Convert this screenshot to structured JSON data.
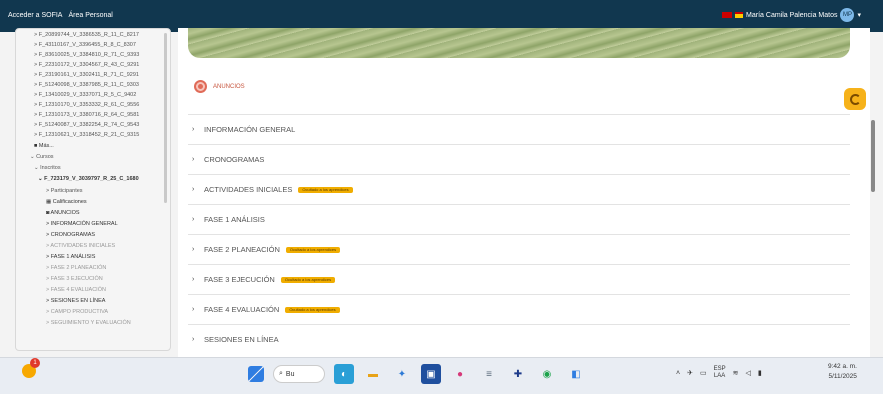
{
  "topbar": {
    "left_links": [
      "Acceder a SOFIA",
      "Área Personal"
    ],
    "user_name": "María Camila Palencia Matos",
    "avatar_initials": "MP"
  },
  "sidebar": {
    "items": [
      "> F_20899744_V_3386535_R_11_C_8217",
      "> F_43110167_V_3396455_R_8_C_8307",
      "> F_83610025_V_3384810_R_71_C_9393",
      "> F_22310172_V_3304567_R_43_C_9291",
      "> F_23190161_V_3302411_R_71_C_9291",
      "> F_51240098_V_3387985_R_11_C_9303",
      "> F_13410029_V_3337071_R_5_C_9402",
      "> F_12310170_V_3353332_R_61_C_9556",
      "> F_12310173_V_3380716_R_64_C_9581",
      "> F_51240087_V_3382254_R_74_C_9543",
      "> F_12310621_V_3318452_R_21_C_9315",
      "Más...",
      "Cursos",
      "Inscritos",
      "F_723179_V_3039797_R_25_C_1680",
      "> Participantes",
      "Calificaciones",
      "ANUNCIOS",
      "> INFORMACIÓN GENERAL",
      "> CRONOGRAMAS",
      "> ACTIVIDADES INICIALES",
      "> FASE 1 ANÁLISIS",
      "> FASE 2 PLANEACIÓN",
      "> FASE 3 EJECUCIÓN",
      "> FASE 4 EVALUACIÓN",
      "> SESIONES EN LÍNEA",
      "> CAMPO PRODUCTIVA",
      "> SEGUIMIENTO Y EVALUACIÓN"
    ]
  },
  "main": {
    "anuncios_label": "ANUNCIOS",
    "sections": [
      {
        "label": "INFORMACIÓN GENERAL",
        "badge": ""
      },
      {
        "label": "CRONOGRAMAS",
        "badge": ""
      },
      {
        "label": "ACTIVIDADES INICIALES",
        "badge": "Ocultado a los aprendices"
      },
      {
        "label": "FASE 1 ANÁLISIS",
        "badge": ""
      },
      {
        "label": "FASE 2 PLANEACIÓN",
        "badge": "Ocultado a los aprendices"
      },
      {
        "label": "FASE 3 EJECUCIÓN",
        "badge": "Ocultado a los aprendices"
      },
      {
        "label": "FASE 4 EVALUACIÓN",
        "badge": "Ocultado a los aprendices"
      },
      {
        "label": "SESIONES EN LÍNEA",
        "badge": ""
      }
    ]
  },
  "taskbar": {
    "search_text": "Bu",
    "notification_count": "1",
    "lang_line1": "ESP",
    "lang_line2": "LAA",
    "time": "9:42 a. m.",
    "date": "5/11/2025"
  },
  "colors": {
    "topbar": "#11374f",
    "badge": "#f0ad00",
    "anuncios": "#e06b58",
    "accent_button": "#f6b21a"
  }
}
